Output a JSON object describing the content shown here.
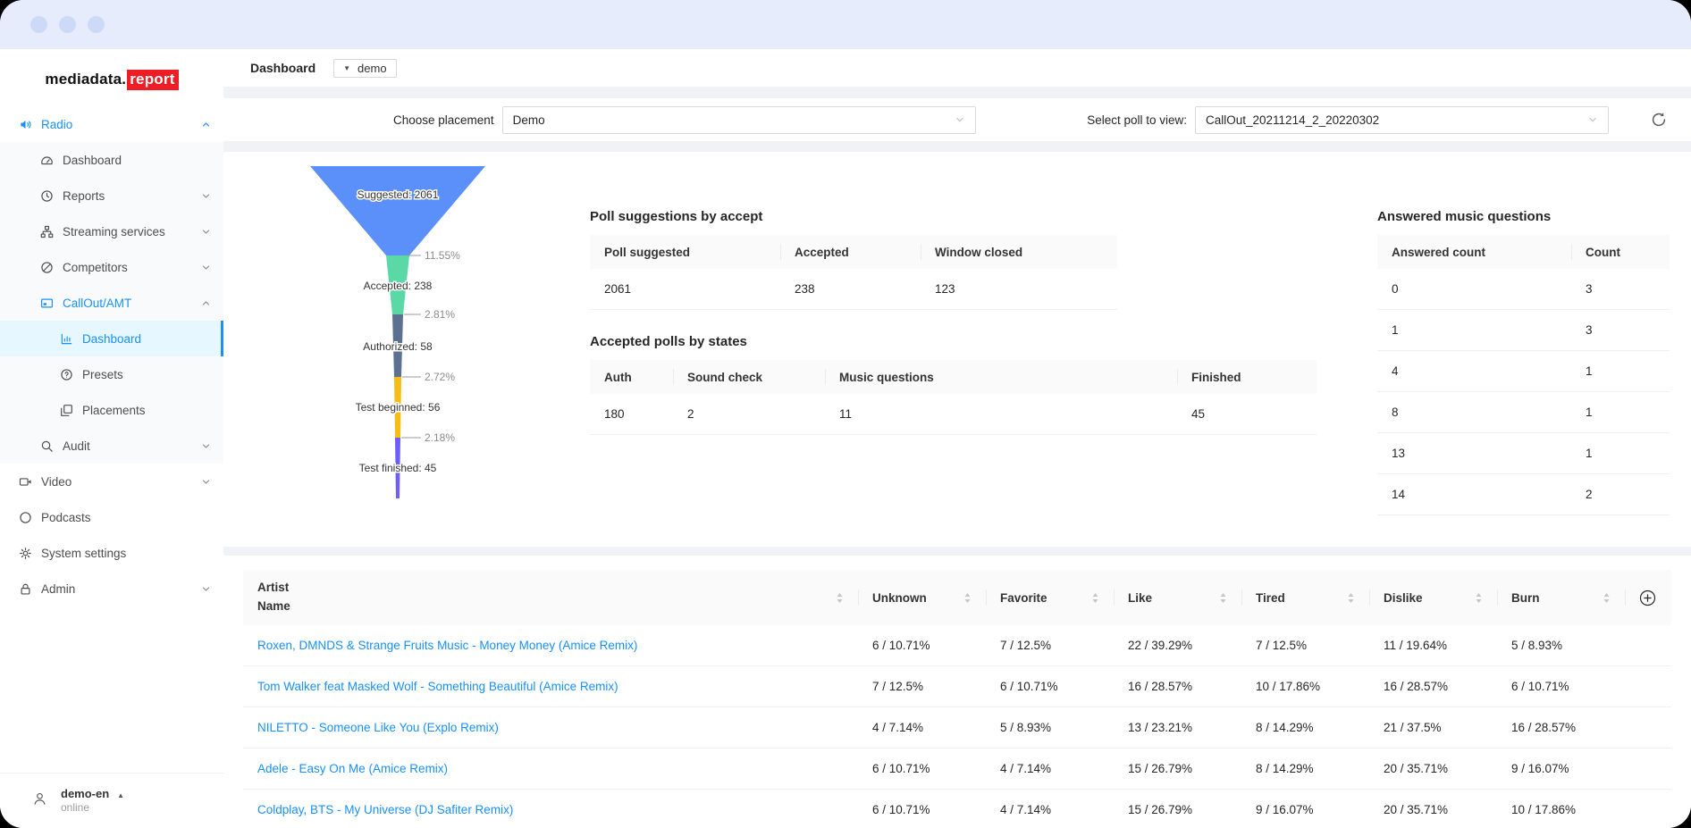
{
  "window": {
    "titlebar_dots": 3
  },
  "colors": {
    "accent_blue": "#1890ff",
    "selected_item_bg": "#e6f7ff",
    "logo_red": "#ee1c25",
    "content_bg": "#f0f2f5",
    "titlebar_bg": "#e6ecfc",
    "funnel": [
      "#5B8FF9",
      "#5AD8A6",
      "#5D7092",
      "#F6BD16",
      "#6F5EF9"
    ],
    "link_blue": "#1890ff"
  },
  "icons": {
    "sound-icon": "speaker with sound waves",
    "dashboard-icon": "gauge",
    "history-icon": "clock",
    "share-icon": "connected nodes",
    "compass-icon": "circle with diagonal",
    "callout-icon": "panel box",
    "bar-chart-icon": "mini bar chart",
    "question-circle-icon": "question mark in circle",
    "copy-icon": "overlapping squares",
    "search-icon": "magnifier",
    "video-icon": "video camera",
    "circle-icon": "circle outline",
    "gear-icon": "cog",
    "lock-icon": "padlock",
    "user-icon": "person outline",
    "reload-icon": "circular refresh arrow",
    "plus-circle-icon": "plus in circle",
    "sorter-icon": "up/down carets",
    "chevron-up-icon": "caret up",
    "chevron-down-icon": "caret down",
    "caret-down-filled": "▼",
    "caret-up-filled": "▲"
  },
  "sidebar": {
    "logo": {
      "black": "mediadata.",
      "red": "report"
    },
    "items": [
      {
        "label": "Radio",
        "icon": "sound-icon",
        "level": 1,
        "active": true,
        "chevron": "up"
      },
      {
        "label": "Dashboard",
        "icon": "dashboard-icon",
        "level": 2
      },
      {
        "label": "Reports",
        "icon": "history-icon",
        "level": 2,
        "chevron": "down"
      },
      {
        "label": "Streaming services",
        "icon": "share-icon",
        "level": 2,
        "chevron": "down"
      },
      {
        "label": "Competitors",
        "icon": "compass-icon",
        "level": 2,
        "chevron": "down"
      },
      {
        "label": "CallOut/AMT",
        "icon": "callout-icon",
        "level": 2,
        "active": true,
        "chevron": "up"
      },
      {
        "label": "Dashboard",
        "icon": "bar-chart-icon",
        "level": 3,
        "selected": true
      },
      {
        "label": "Presets",
        "icon": "question-circle-icon",
        "level": 3
      },
      {
        "label": "Placements",
        "icon": "copy-icon",
        "level": 3
      },
      {
        "label": "Audit",
        "icon": "search-icon",
        "level": 2,
        "chevron": "down"
      },
      {
        "label": "Video",
        "icon": "video-icon",
        "level": 1,
        "chevron": "down"
      },
      {
        "label": "Podcasts",
        "icon": "circle-icon",
        "level": 1
      },
      {
        "label": "System settings",
        "icon": "gear-icon",
        "level": 1
      },
      {
        "label": "Admin",
        "icon": "lock-icon",
        "level": 1,
        "chevron": "down"
      }
    ],
    "user": {
      "name": "demo-en",
      "status": "online"
    }
  },
  "topbar": {
    "title": "Dashboard",
    "env_value": "demo"
  },
  "filters": {
    "placement_label": "Choose placement",
    "placement_value": "Demo",
    "poll_label": "Select poll to view:",
    "poll_value": "CallOut_20211214_2_20220302"
  },
  "chart_data": {
    "type": "funnel",
    "title": "",
    "legend_position": "none",
    "stages": [
      {
        "label": "Suggested",
        "value": 2061,
        "display": "Suggested: 2061",
        "color": "#5B8FF9"
      },
      {
        "label": "Accepted",
        "value": 238,
        "display": "Accepted: 238",
        "color": "#5AD8A6"
      },
      {
        "label": "Authorized",
        "value": 58,
        "display": "Authorized: 58",
        "color": "#5D7092"
      },
      {
        "label": "Test beginned",
        "value": 56,
        "display": "Test beginned: 56",
        "color": "#F6BD16"
      },
      {
        "label": "Test finished",
        "value": 45,
        "display": "Test finished: 45",
        "color": "#6F5EF9"
      }
    ],
    "conversion_labels": [
      "11.55%",
      "2.81%",
      "2.72%",
      "2.18%"
    ]
  },
  "tables": {
    "poll_suggestions": {
      "title": "Poll suggestions by accept",
      "headers": [
        "Poll suggested",
        "Accepted",
        "Window closed"
      ],
      "rows": [
        [
          "2061",
          "238",
          "123"
        ]
      ]
    },
    "accepted_polls": {
      "title": "Accepted polls by states",
      "headers": [
        "Auth",
        "Sound check",
        "Music questions",
        "Finished"
      ],
      "rows": [
        [
          "180",
          "2",
          "11",
          "45"
        ]
      ]
    },
    "answered_questions": {
      "title": "Answered music questions",
      "headers": [
        "Answered count",
        "Count"
      ],
      "rows": [
        [
          "0",
          "3"
        ],
        [
          "1",
          "3"
        ],
        [
          "4",
          "1"
        ],
        [
          "8",
          "1"
        ],
        [
          "13",
          "1"
        ],
        [
          "14",
          "2"
        ]
      ]
    },
    "songs": {
      "headers": [
        "Artist Name",
        "Unknown",
        "Favorite",
        "Like",
        "Tired",
        "Dislike",
        "Burn"
      ],
      "rows": [
        {
          "name": "Roxen, DMNDS & Strange Fruits Music - Money Money (Amice Remix)",
          "values": [
            "6 / 10.71%",
            "7 / 12.5%",
            "22 / 39.29%",
            "7 / 12.5%",
            "11 / 19.64%",
            "5 / 8.93%"
          ]
        },
        {
          "name": "Tom Walker feat Masked Wolf - Something Beautiful (Amice Remix)",
          "values": [
            "7 / 12.5%",
            "6 / 10.71%",
            "16 / 28.57%",
            "10 / 17.86%",
            "16 / 28.57%",
            "6 / 10.71%"
          ]
        },
        {
          "name": "NILETTO - Someone Like You (Explo Remix)",
          "values": [
            "4 / 7.14%",
            "5 / 8.93%",
            "13 / 23.21%",
            "8 / 14.29%",
            "21 / 37.5%",
            "16 / 28.57%"
          ]
        },
        {
          "name": "Adele - Easy On Me (Amice Remix)",
          "values": [
            "6 / 10.71%",
            "4 / 7.14%",
            "15 / 26.79%",
            "8 / 14.29%",
            "20 / 35.71%",
            "9 / 16.07%"
          ]
        },
        {
          "name": "Coldplay, BTS - My Universe (DJ Safiter Remix)",
          "values": [
            "6 / 10.71%",
            "4 / 7.14%",
            "15 / 26.79%",
            "9 / 16.07%",
            "20 / 35.71%",
            "10 / 17.86%"
          ]
        }
      ]
    }
  }
}
